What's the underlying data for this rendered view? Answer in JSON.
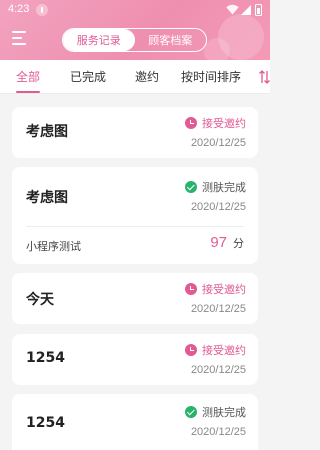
{
  "status_bar": {
    "time": "4:23"
  },
  "header": {
    "segments": [
      {
        "label": "服务记录",
        "active": true
      },
      {
        "label": "顾客档案",
        "active": false
      }
    ]
  },
  "tabs": [
    {
      "label": "全部",
      "active": true
    },
    {
      "label": "已完成",
      "active": false
    },
    {
      "label": "邀约",
      "active": false
    },
    {
      "label": "按时间排序",
      "active": false
    }
  ],
  "records": [
    {
      "title": "考虑图",
      "status": "接受邀约",
      "status_type": "accepted",
      "date": "2020/12/25"
    },
    {
      "title": "考虑图",
      "status": "测肤完成",
      "status_type": "completed",
      "date": "2020/12/25",
      "extra": {
        "label": "小程序测试",
        "score": "97",
        "unit": "分"
      }
    },
    {
      "title": "今天",
      "status": "接受邀约",
      "status_type": "accepted",
      "date": "2020/12/25"
    },
    {
      "title": "1254",
      "status": "接受邀约",
      "status_type": "accepted",
      "date": "2020/12/25"
    },
    {
      "title": "1254",
      "status": "测肤完成",
      "status_type": "completed",
      "date": "2020/12/25"
    }
  ],
  "colors": {
    "accent": "#e05a93",
    "header_pink": "#ef8fb0",
    "success": "#27b36a"
  },
  "icons": [
    "alert-icon",
    "wifi-icon",
    "signal-icon",
    "battery-icon",
    "menu-icon",
    "sort-icon",
    "clock-icon",
    "check-circle-icon"
  ]
}
